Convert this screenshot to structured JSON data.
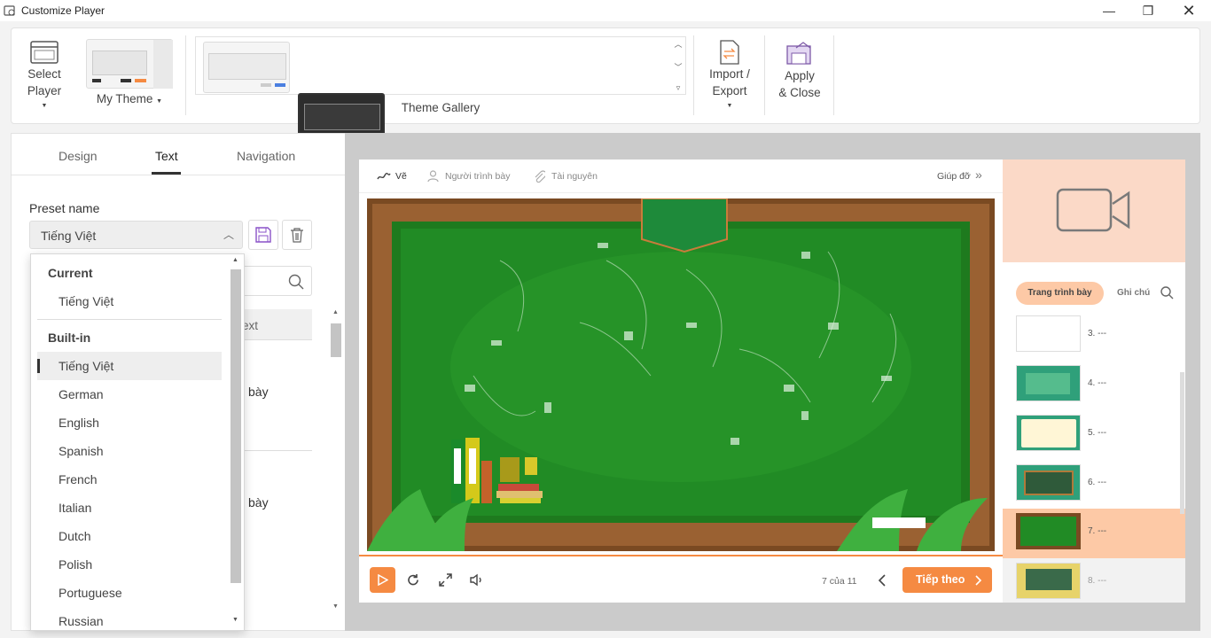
{
  "window": {
    "title": "Customize Player"
  },
  "ribbon": {
    "select_player": [
      "Select",
      "Player"
    ],
    "my_theme": "My Theme",
    "theme_gallery": "Theme Gallery",
    "import_export": [
      "Import /",
      "Export"
    ],
    "apply_close": [
      "Apply",
      "& Close"
    ]
  },
  "tabs": {
    "design": "Design",
    "text": "Text",
    "navigation": "Navigation"
  },
  "preset": {
    "label": "Preset name",
    "value": "Tiếng Việt",
    "current_header": "Current",
    "current_item": "Tiếng Việt",
    "builtin_header": "Built-in",
    "builtin_items": [
      "Tiếng Việt",
      "German",
      "English",
      "Spanish",
      "French",
      "Italian",
      "Dutch",
      "Polish",
      "Portuguese",
      "Russian"
    ]
  },
  "behind": {
    "col_fragment": "ext",
    "row1": "bày",
    "row2": "bày"
  },
  "player": {
    "toolbar": {
      "draw": "Vẽ",
      "presenter": "Người trình bày",
      "resources": "Tài nguyên",
      "help": "Giúp đỡ"
    },
    "counter": "7 của 11",
    "next": "Tiếp theo",
    "side_tabs": {
      "outline": "Trang trình bày",
      "notes": "Ghi chú"
    },
    "slides": [
      {
        "label": "3. ---"
      },
      {
        "label": "4. ---"
      },
      {
        "label": "5. ---"
      },
      {
        "label": "6. ---"
      },
      {
        "label": "7. ---"
      },
      {
        "label": "8. ---"
      }
    ]
  },
  "colors": {
    "accent": "#f58a42",
    "highlight": "#fdc9a6",
    "camera_bg": "#fbd9c7"
  }
}
